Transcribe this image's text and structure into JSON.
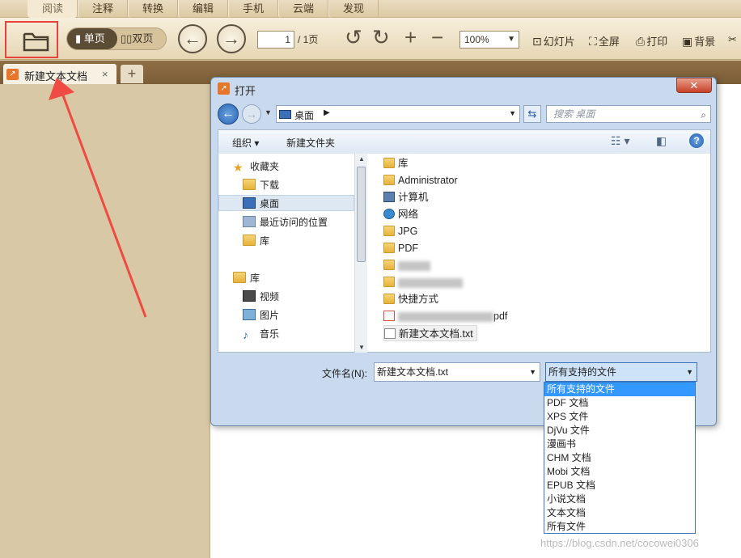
{
  "app": {
    "menu_tabs": [
      "阅读",
      "注释",
      "转换",
      "编辑",
      "手机",
      "云端",
      "发现"
    ],
    "toolbar": {
      "single_page": "单页",
      "double_page": "双页",
      "page_current": "1",
      "page_total": "/ 1页",
      "zoom": "100%",
      "slideshow": "幻灯片",
      "fullscreen": "全屏",
      "print": "打印",
      "background": "背景"
    },
    "doc_tab": {
      "name": "新建文本文档",
      "close": "×",
      "new": "+"
    }
  },
  "dialog": {
    "title": "打开",
    "close": "✕",
    "path": "桌面",
    "search_placeholder": "搜索 桌面",
    "commands": {
      "organize": "组织 ▾",
      "new_folder": "新建文件夹"
    },
    "tree": [
      "收藏夹",
      "下载",
      "桌面",
      "最近访问的位置",
      "库",
      "库",
      "视频",
      "图片",
      "音乐"
    ],
    "files": [
      "库",
      "Administrator",
      "计算机",
      "网络",
      "JPG",
      "PDF",
      "",
      "",
      "快捷方式",
      "pdf",
      "新建文本文档.txt"
    ],
    "filename_label": "文件名(N):",
    "filename_value": "新建文本文档.txt",
    "filetype_value": "所有支持的文件",
    "filetype_options": [
      "所有支持的文件",
      "PDF 文档",
      "XPS 文件",
      "DjVu 文件",
      "漫画书",
      "CHM 文档",
      "Mobi 文档",
      "EPUB 文档",
      "小说文档",
      "文本文档",
      "所有文件"
    ]
  },
  "watermark": "https://blog.csdn.net/cocowei0306",
  "colors": {
    "highlight_box": "#e8443a",
    "arrow": "#f04b42",
    "dropdown_highlight": "#3399ff"
  }
}
